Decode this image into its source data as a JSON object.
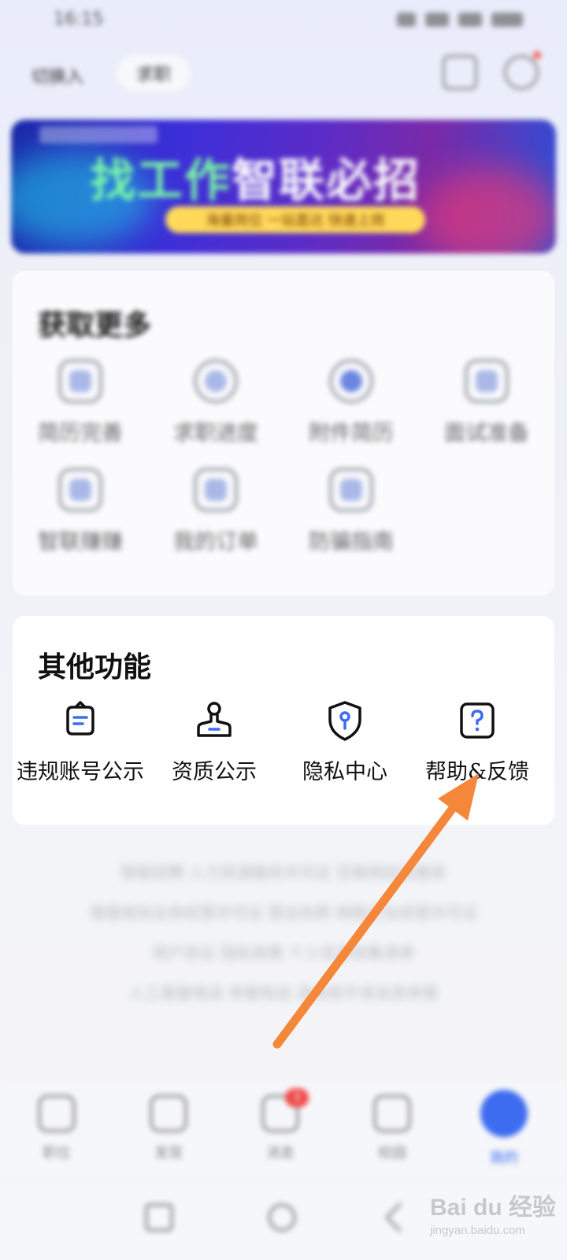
{
  "status_bar": {
    "time": "16:15"
  },
  "header": {
    "city": "切换入",
    "switch_label": "求职"
  },
  "banner": {
    "title_part1": "找工作",
    "title_part2": "智联必招",
    "subtitle": "海量岗位 一站直达 快速上岗"
  },
  "more_section": {
    "title": "获取更多",
    "items": [
      {
        "label": "简历完善",
        "icon": "monitor-icon"
      },
      {
        "label": "求职进度",
        "icon": "clock-icon"
      },
      {
        "label": "附件简历",
        "icon": "globe-icon"
      },
      {
        "label": "面试准备",
        "icon": "hat-icon"
      },
      {
        "label": "智联赚赚",
        "icon": "bag-icon"
      },
      {
        "label": "我的订单",
        "icon": "clipboard-icon"
      },
      {
        "label": "防骗指南",
        "icon": "document-icon"
      }
    ]
  },
  "other_section": {
    "title": "其他功能",
    "items": [
      {
        "label": "违规账号公示",
        "icon": "chat-bubble-icon"
      },
      {
        "label": "资质公示",
        "icon": "stamp-icon"
      },
      {
        "label": "隐私中心",
        "icon": "shield-key-icon"
      },
      {
        "label": "帮助&反馈",
        "icon": "question-icon"
      }
    ]
  },
  "footer": {
    "lines": [
      "智联招聘 人力资源服务许可证 互联网信息服务",
      "增值电信业务经营许可证 营业执照 网络文化经营许可证",
      "用户协议 隐私政策 个人信息收集清单",
      "人工客服电话 举报电话 违法和不良信息举报"
    ]
  },
  "bottom_nav": {
    "items": [
      {
        "label": "职位"
      },
      {
        "label": "发现"
      },
      {
        "label": "消息",
        "badge": "3"
      },
      {
        "label": "校园"
      },
      {
        "label": "我的"
      }
    ],
    "active_color": "#3d6cf0"
  },
  "watermark": {
    "logo": "Bai du 经验",
    "url": "jingyan.baidu.com"
  },
  "colors": {
    "accent": "#3d6cf0",
    "arrow": "#f5873a"
  }
}
